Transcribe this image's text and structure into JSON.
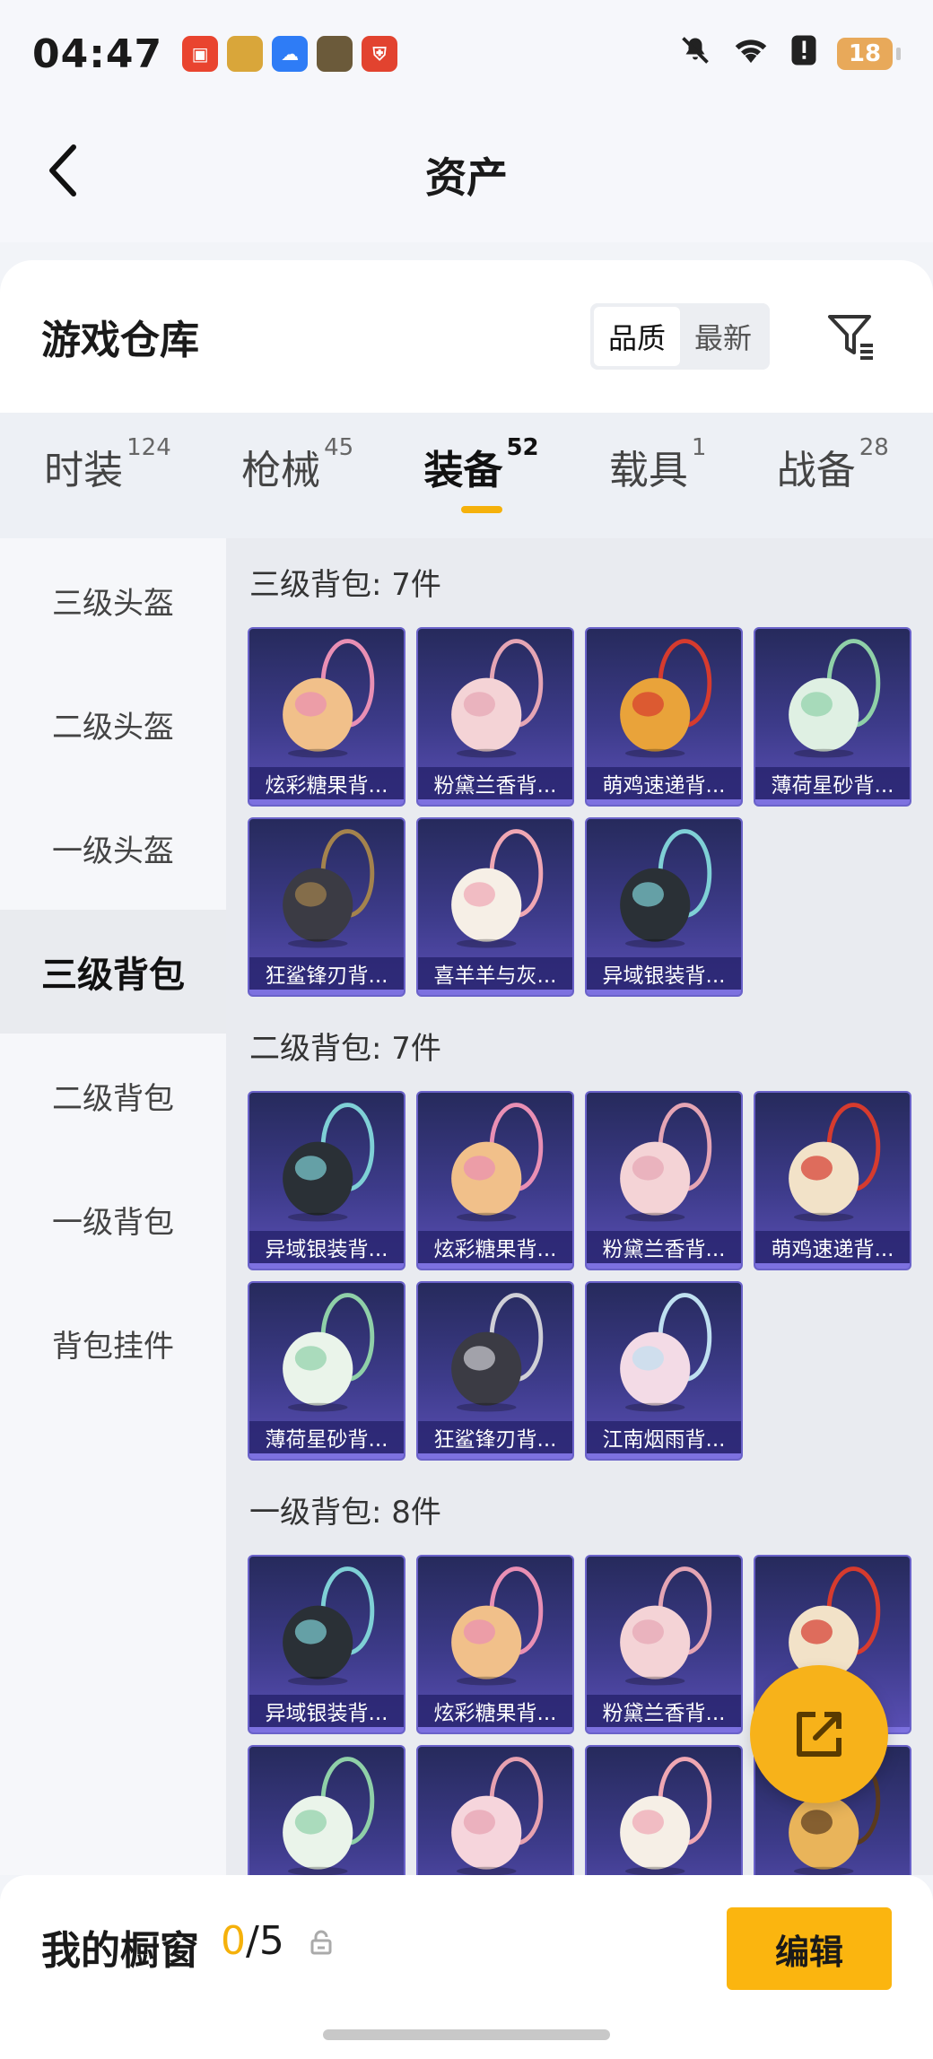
{
  "status_bar": {
    "time": "04:47",
    "battery": "18",
    "app_icons": [
      {
        "name": "recorder-app-icon",
        "color": "#e9442f",
        "glyph": "▣"
      },
      {
        "name": "game-app-icon",
        "color": "#d9a63a",
        "glyph": ""
      },
      {
        "name": "weather-app-icon",
        "color": "#2e7cf6",
        "glyph": "☁"
      },
      {
        "name": "pubg-app-icon",
        "color": "#6b5a3a",
        "glyph": ""
      },
      {
        "name": "security-app-icon",
        "color": "#e2432f",
        "glyph": "⛨"
      }
    ]
  },
  "nav": {
    "title": "资产"
  },
  "warehouse": {
    "title": "游戏仓库",
    "sort_options": [
      "品质",
      "最新"
    ],
    "active_sort": 0
  },
  "tabs": [
    {
      "label": "时装",
      "count": "124"
    },
    {
      "label": "枪械",
      "count": "45"
    },
    {
      "label": "装备",
      "count": "52",
      "active": true
    },
    {
      "label": "载具",
      "count": "1"
    },
    {
      "label": "战备",
      "count": "28"
    }
  ],
  "sidebar": [
    "三级头盔",
    "二级头盔",
    "一级头盔",
    "三级背包",
    "二级背包",
    "一级背包",
    "背包挂件"
  ],
  "sidebar_active": 3,
  "sections": [
    {
      "title": "三级背包: 7件",
      "items": [
        {
          "label": "炫彩糖果背...",
          "color": "#f1c08a",
          "accent": "#e98fb4"
        },
        {
          "label": "粉黛兰香背...",
          "color": "#f4d3d6",
          "accent": "#e5a5b4"
        },
        {
          "label": "萌鸡速递背...",
          "color": "#e9a33a",
          "accent": "#d63b2e"
        },
        {
          "label": "薄荷星砂背...",
          "color": "#dff0e3",
          "accent": "#8fd0a8"
        },
        {
          "label": "狂鲨锋刃背...",
          "color": "#3b3b44",
          "accent": "#a4834d"
        },
        {
          "label": "喜羊羊与灰...",
          "color": "#f6efe6",
          "accent": "#f0a7b3"
        },
        {
          "label": "异域银装背...",
          "color": "#2a3036",
          "accent": "#7fd0d6"
        }
      ]
    },
    {
      "title": "二级背包: 7件",
      "items": [
        {
          "label": "异域银装背...",
          "color": "#2a3036",
          "accent": "#7fd0d6"
        },
        {
          "label": "炫彩糖果背...",
          "color": "#f1c08a",
          "accent": "#e98fb4"
        },
        {
          "label": "粉黛兰香背...",
          "color": "#f4d3d6",
          "accent": "#e5a5b4"
        },
        {
          "label": "萌鸡速递背...",
          "color": "#f2e2c8",
          "accent": "#d63b2e"
        },
        {
          "label": "薄荷星砂背...",
          "color": "#eaf4ea",
          "accent": "#8fd0a8"
        },
        {
          "label": "狂鲨锋刃背...",
          "color": "#3b3b44",
          "accent": "#cfcfd6"
        },
        {
          "label": "江南烟雨背...",
          "color": "#f3dbe6",
          "accent": "#bfe0f0"
        }
      ]
    },
    {
      "title": "一级背包: 8件",
      "items": [
        {
          "label": "异域银装背...",
          "color": "#2a3036",
          "accent": "#7fd0d6"
        },
        {
          "label": "炫彩糖果背...",
          "color": "#f1c08a",
          "accent": "#e98fb4"
        },
        {
          "label": "粉黛兰香背...",
          "color": "#f4d3d6",
          "accent": "#e5a5b4"
        },
        {
          "label": "",
          "color": "#f2e2c8",
          "accent": "#d63b2e"
        },
        {
          "label": "",
          "color": "#eaf4ea",
          "accent": "#8fd0a8"
        },
        {
          "label": "",
          "color": "#f6d5dc",
          "accent": "#e7a1b0"
        },
        {
          "label": "",
          "color": "#f6efe6",
          "accent": "#f0a7b3"
        },
        {
          "label": "",
          "color": "#e9b45a",
          "accent": "#5a3a1e"
        }
      ]
    }
  ],
  "bottom": {
    "showcase_label": "我的橱窗",
    "showcase_current": "0",
    "showcase_total": "/5",
    "edit_label": "编辑"
  }
}
